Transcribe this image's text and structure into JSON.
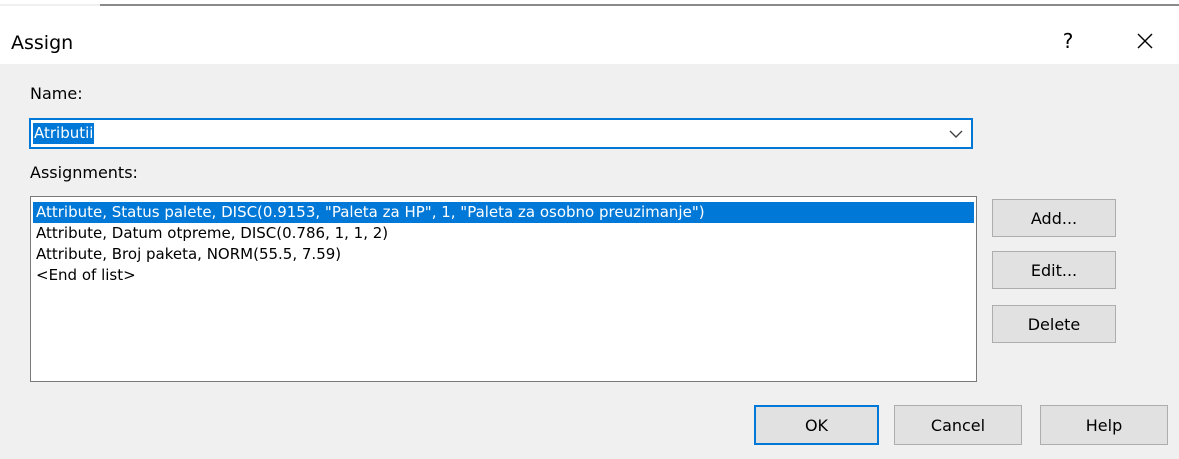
{
  "window": {
    "title": "Assign",
    "help_label": "?"
  },
  "name_field": {
    "label": "Name:",
    "value": "Atributii"
  },
  "assignments": {
    "label": "Assignments:",
    "items": [
      "Attribute, Status palete, DISC(0.9153, \"Paleta za HP\", 1, \"Paleta za osobno preuzimanje\")",
      "Attribute, Datum otpreme, DISC(0.786, 1, 1, 2)",
      "Attribute, Broj paketa, NORM(55.5, 7.59)",
      "<End of list>"
    ],
    "selected_index": 0
  },
  "side_buttons": {
    "add": "Add...",
    "edit": "Edit...",
    "delete": "Delete"
  },
  "footer_buttons": {
    "ok": "OK",
    "cancel": "Cancel",
    "help": "Help"
  },
  "colors": {
    "accent": "#0078d7",
    "dialog_bg": "#f0f0f0",
    "button_bg": "#e1e1e1"
  },
  "icons": {
    "close": "close-icon",
    "dropdown": "chevron-down-icon"
  }
}
